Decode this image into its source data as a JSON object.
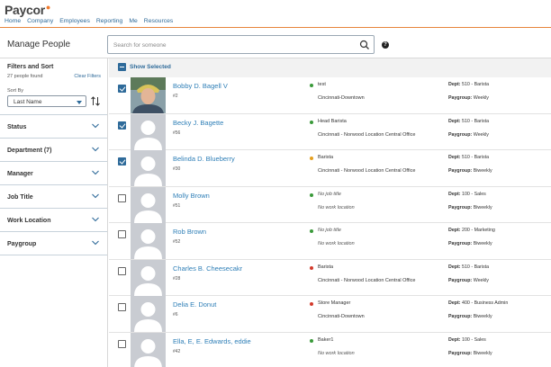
{
  "header": {
    "logo": "Paycor",
    "nav": [
      "Home",
      "Company",
      "Employees",
      "Reporting",
      "Me",
      "Resources"
    ]
  },
  "page": {
    "title": "Manage People",
    "search_placeholder": "Search for someone",
    "help": "?"
  },
  "sidebar": {
    "title": "Filters and Sort",
    "count": "27 people found",
    "clear": "Clear Filters",
    "sort_label": "Sort By",
    "sort_value": "Last Name",
    "filters": [
      "Status",
      "Department (7)",
      "Manager",
      "Job Title",
      "Work Location",
      "Paygroup"
    ]
  },
  "list": {
    "show_selected": "Show Selected",
    "dept_label": "Dept:",
    "paygroup_label": "Paygroup:",
    "rows": [
      {
        "name": "Bobby D. Bagell V",
        "id": "#2",
        "job": "test",
        "location": "Cincinnati-Downtown",
        "dept": "510 - Barista",
        "paygroup": "Weekly",
        "checked": true,
        "photo": true,
        "status_color": "#3a9a3a"
      },
      {
        "name": "Becky J. Bagette",
        "id": "#56",
        "job": "Head Barista",
        "location": "Cincinnati - Norwood Location Central Office",
        "dept": "510 - Barista",
        "paygroup": "Weekly",
        "checked": true,
        "photo": false,
        "status_color": "#3a9a3a"
      },
      {
        "name": "Belinda D. Blueberry",
        "id": "#30",
        "job": "Barista",
        "location": "Cincinnati - Norwood Location Central Office",
        "dept": "510 - Barista",
        "paygroup": "Biweekly",
        "checked": true,
        "photo": false,
        "status_color": "#e5a020"
      },
      {
        "name": "Molly Brown",
        "id": "#51",
        "job": "No job title",
        "location": "No work location",
        "dept": "100 - Sales",
        "paygroup": "Biweekly",
        "checked": false,
        "photo": false,
        "status_color": "#3a9a3a",
        "muted": true
      },
      {
        "name": "Rob Brown",
        "id": "#52",
        "job": "No job title",
        "location": "No work location",
        "dept": "200 - Marketing",
        "paygroup": "Biweekly",
        "checked": false,
        "photo": false,
        "status_color": "#3a9a3a",
        "muted": true
      },
      {
        "name": "Charles B. Cheesecakr",
        "id": "#28",
        "job": "Barista",
        "location": "Cincinnati - Norwood Location Central Office",
        "dept": "510 - Barista",
        "paygroup": "Weekly",
        "checked": false,
        "photo": false,
        "status_color": "#d33a2c"
      },
      {
        "name": "Delia E. Donut",
        "id": "#6",
        "job": "Store Manager",
        "location": "Cincinnati-Downtown",
        "dept": "400 - Business Admin",
        "paygroup": "Biweekly",
        "checked": false,
        "photo": false,
        "status_color": "#d33a2c"
      },
      {
        "name": "Ella, E, E. Edwards, eddie",
        "id": "#42",
        "job": "Baker1",
        "location": "No work location",
        "dept": "100 - Sales",
        "paygroup": "Biweekly",
        "checked": false,
        "photo": false,
        "status_color": "#3a9a3a",
        "muted_location": true
      }
    ]
  }
}
